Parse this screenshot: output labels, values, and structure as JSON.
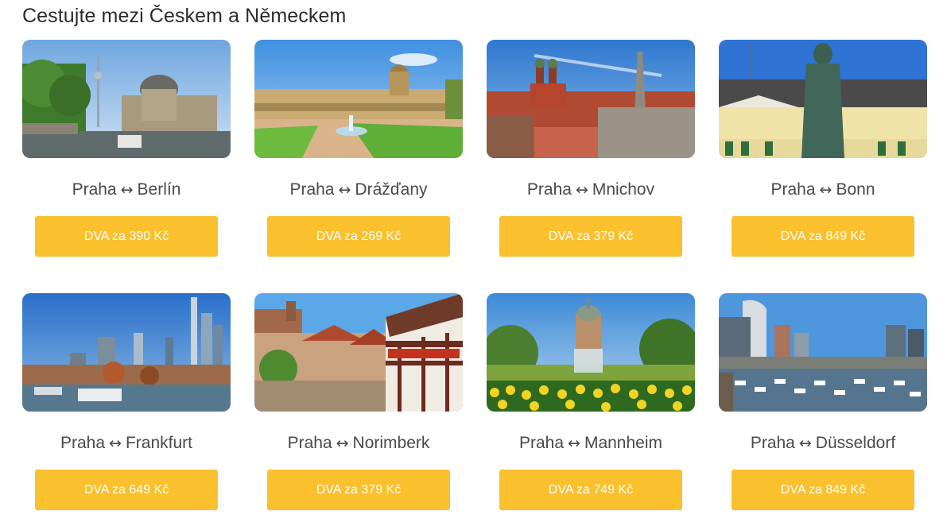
{
  "heading": "Cestujte mezi Českem a Německem",
  "routes": [
    {
      "from": "Praha",
      "arrow": "↔",
      "to": "Berlín",
      "button": "DVA za 390 Kč"
    },
    {
      "from": "Praha",
      "arrow": "↔",
      "to": "Drážďany",
      "button": "DVA za 269 Kč"
    },
    {
      "from": "Praha",
      "arrow": "↔",
      "to": "Mnichov",
      "button": "DVA za 379 Kč"
    },
    {
      "from": "Praha",
      "arrow": "↔",
      "to": "Bonn",
      "button": "DVA za 849 Kč"
    },
    {
      "from": "Praha",
      "arrow": "↔",
      "to": "Frankfurt",
      "button": "DVA za 649 Kč"
    },
    {
      "from": "Praha",
      "arrow": "↔",
      "to": "Norimberk",
      "button": "DVA za 379 Kč"
    },
    {
      "from": "Praha",
      "arrow": "↔",
      "to": "Mannheim",
      "button": "DVA za 749 Kč"
    },
    {
      "from": "Praha",
      "arrow": "↔",
      "to": "Düsseldorf",
      "button": "DVA za 849 Kč"
    }
  ],
  "colors": {
    "button_bg": "#fbc02d",
    "button_text": "#ffffff",
    "heading_text": "#2b2b2b",
    "route_text": "#4a4a4a"
  }
}
